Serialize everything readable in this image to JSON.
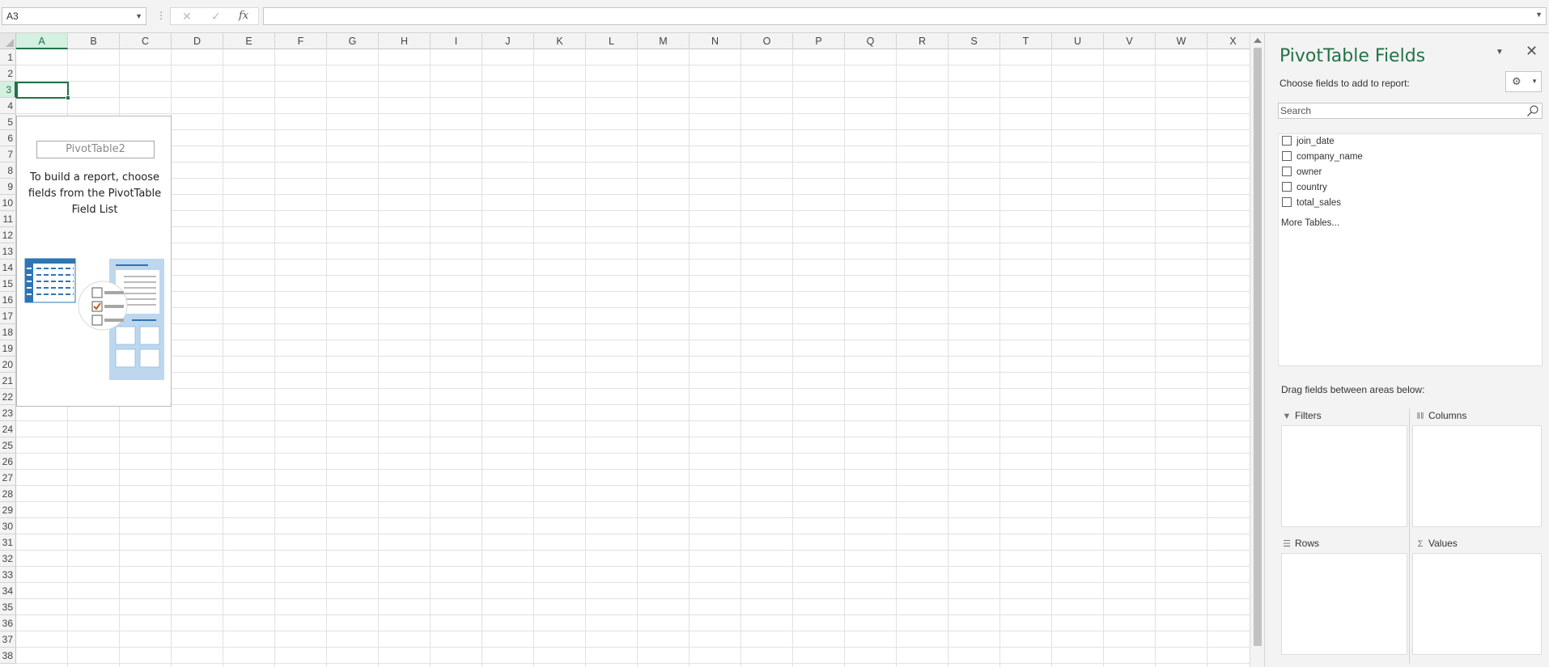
{
  "formula_bar": {
    "name_box": "A3",
    "separator": "⋮",
    "cancel_symbol": "✕",
    "enter_symbol": "✓",
    "fx_label": "fx",
    "formula": ""
  },
  "grid": {
    "columns": [
      "A",
      "B",
      "C",
      "D",
      "E",
      "F",
      "G",
      "H",
      "I",
      "J",
      "K",
      "L",
      "M",
      "N",
      "O",
      "P",
      "Q",
      "R",
      "S",
      "T",
      "U",
      "V",
      "W",
      "X"
    ],
    "rows": [
      "1",
      "2",
      "3",
      "4",
      "5",
      "6",
      "7",
      "8",
      "9",
      "10",
      "11",
      "12",
      "13",
      "14",
      "15",
      "16",
      "17",
      "18",
      "19",
      "20",
      "21",
      "22",
      "23",
      "24",
      "25",
      "26",
      "27",
      "28",
      "29",
      "30",
      "31",
      "32",
      "33",
      "34",
      "35",
      "36",
      "37",
      "38"
    ],
    "selected_column": "A",
    "selected_row": "3"
  },
  "pivot_placeholder": {
    "name": "PivotTable2",
    "instruction": "To build a report, choose fields from the PivotTable Field List"
  },
  "pivot_panel": {
    "title": "PivotTable Fields",
    "choose_label": "Choose fields to add to report:",
    "search_placeholder": "Search",
    "fields": [
      {
        "label": "join_date",
        "checked": false
      },
      {
        "label": "company_name",
        "checked": false
      },
      {
        "label": "owner",
        "checked": false
      },
      {
        "label": "country",
        "checked": false
      },
      {
        "label": "total_sales",
        "checked": false
      }
    ],
    "more_tables": "More Tables...",
    "drag_label": "Drag fields between areas below:",
    "areas": {
      "filters": "Filters",
      "columns": "Columns",
      "rows": "Rows",
      "values": "Values"
    }
  },
  "colors": {
    "accent": "#217346",
    "illustration_blue": "#2e75b6",
    "illustration_light": "#bdd7ee"
  }
}
